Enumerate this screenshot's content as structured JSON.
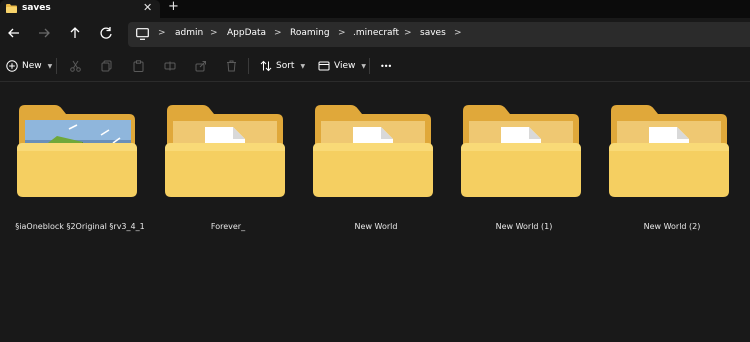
{
  "tab": {
    "title": "saves",
    "close_glyph": "✕",
    "new_tab_glyph": "+"
  },
  "nav": {
    "back_icon": "back-arrow-icon",
    "forward_icon": "forward-arrow-icon",
    "up_icon": "up-arrow-icon",
    "refresh_icon": "refresh-icon"
  },
  "breadcrumb": {
    "separator": ">",
    "items": [
      "admin",
      "AppData",
      "Roaming",
      ".minecraft",
      "saves"
    ]
  },
  "commands": {
    "new_label": "New",
    "sort_label": "Sort",
    "view_label": "View",
    "more_glyph": "•••"
  },
  "folders": [
    {
      "name": "§iaOneblock §2Original §rv3_4_1",
      "thumbnail": "minecraft-world-preview"
    },
    {
      "name": "Forever_",
      "thumbnail": "document-page"
    },
    {
      "name": "New World",
      "thumbnail": "document-page"
    },
    {
      "name": "New World (1)",
      "thumbnail": "document-page"
    },
    {
      "name": "New World (2)",
      "thumbnail": "document-page"
    }
  ],
  "colors": {
    "background": "#191919",
    "tab_strip": "#0b0b0b",
    "address_bar": "#2b2b2b",
    "folder_front": "#f5cf61",
    "folder_back": "#e0a83a"
  }
}
